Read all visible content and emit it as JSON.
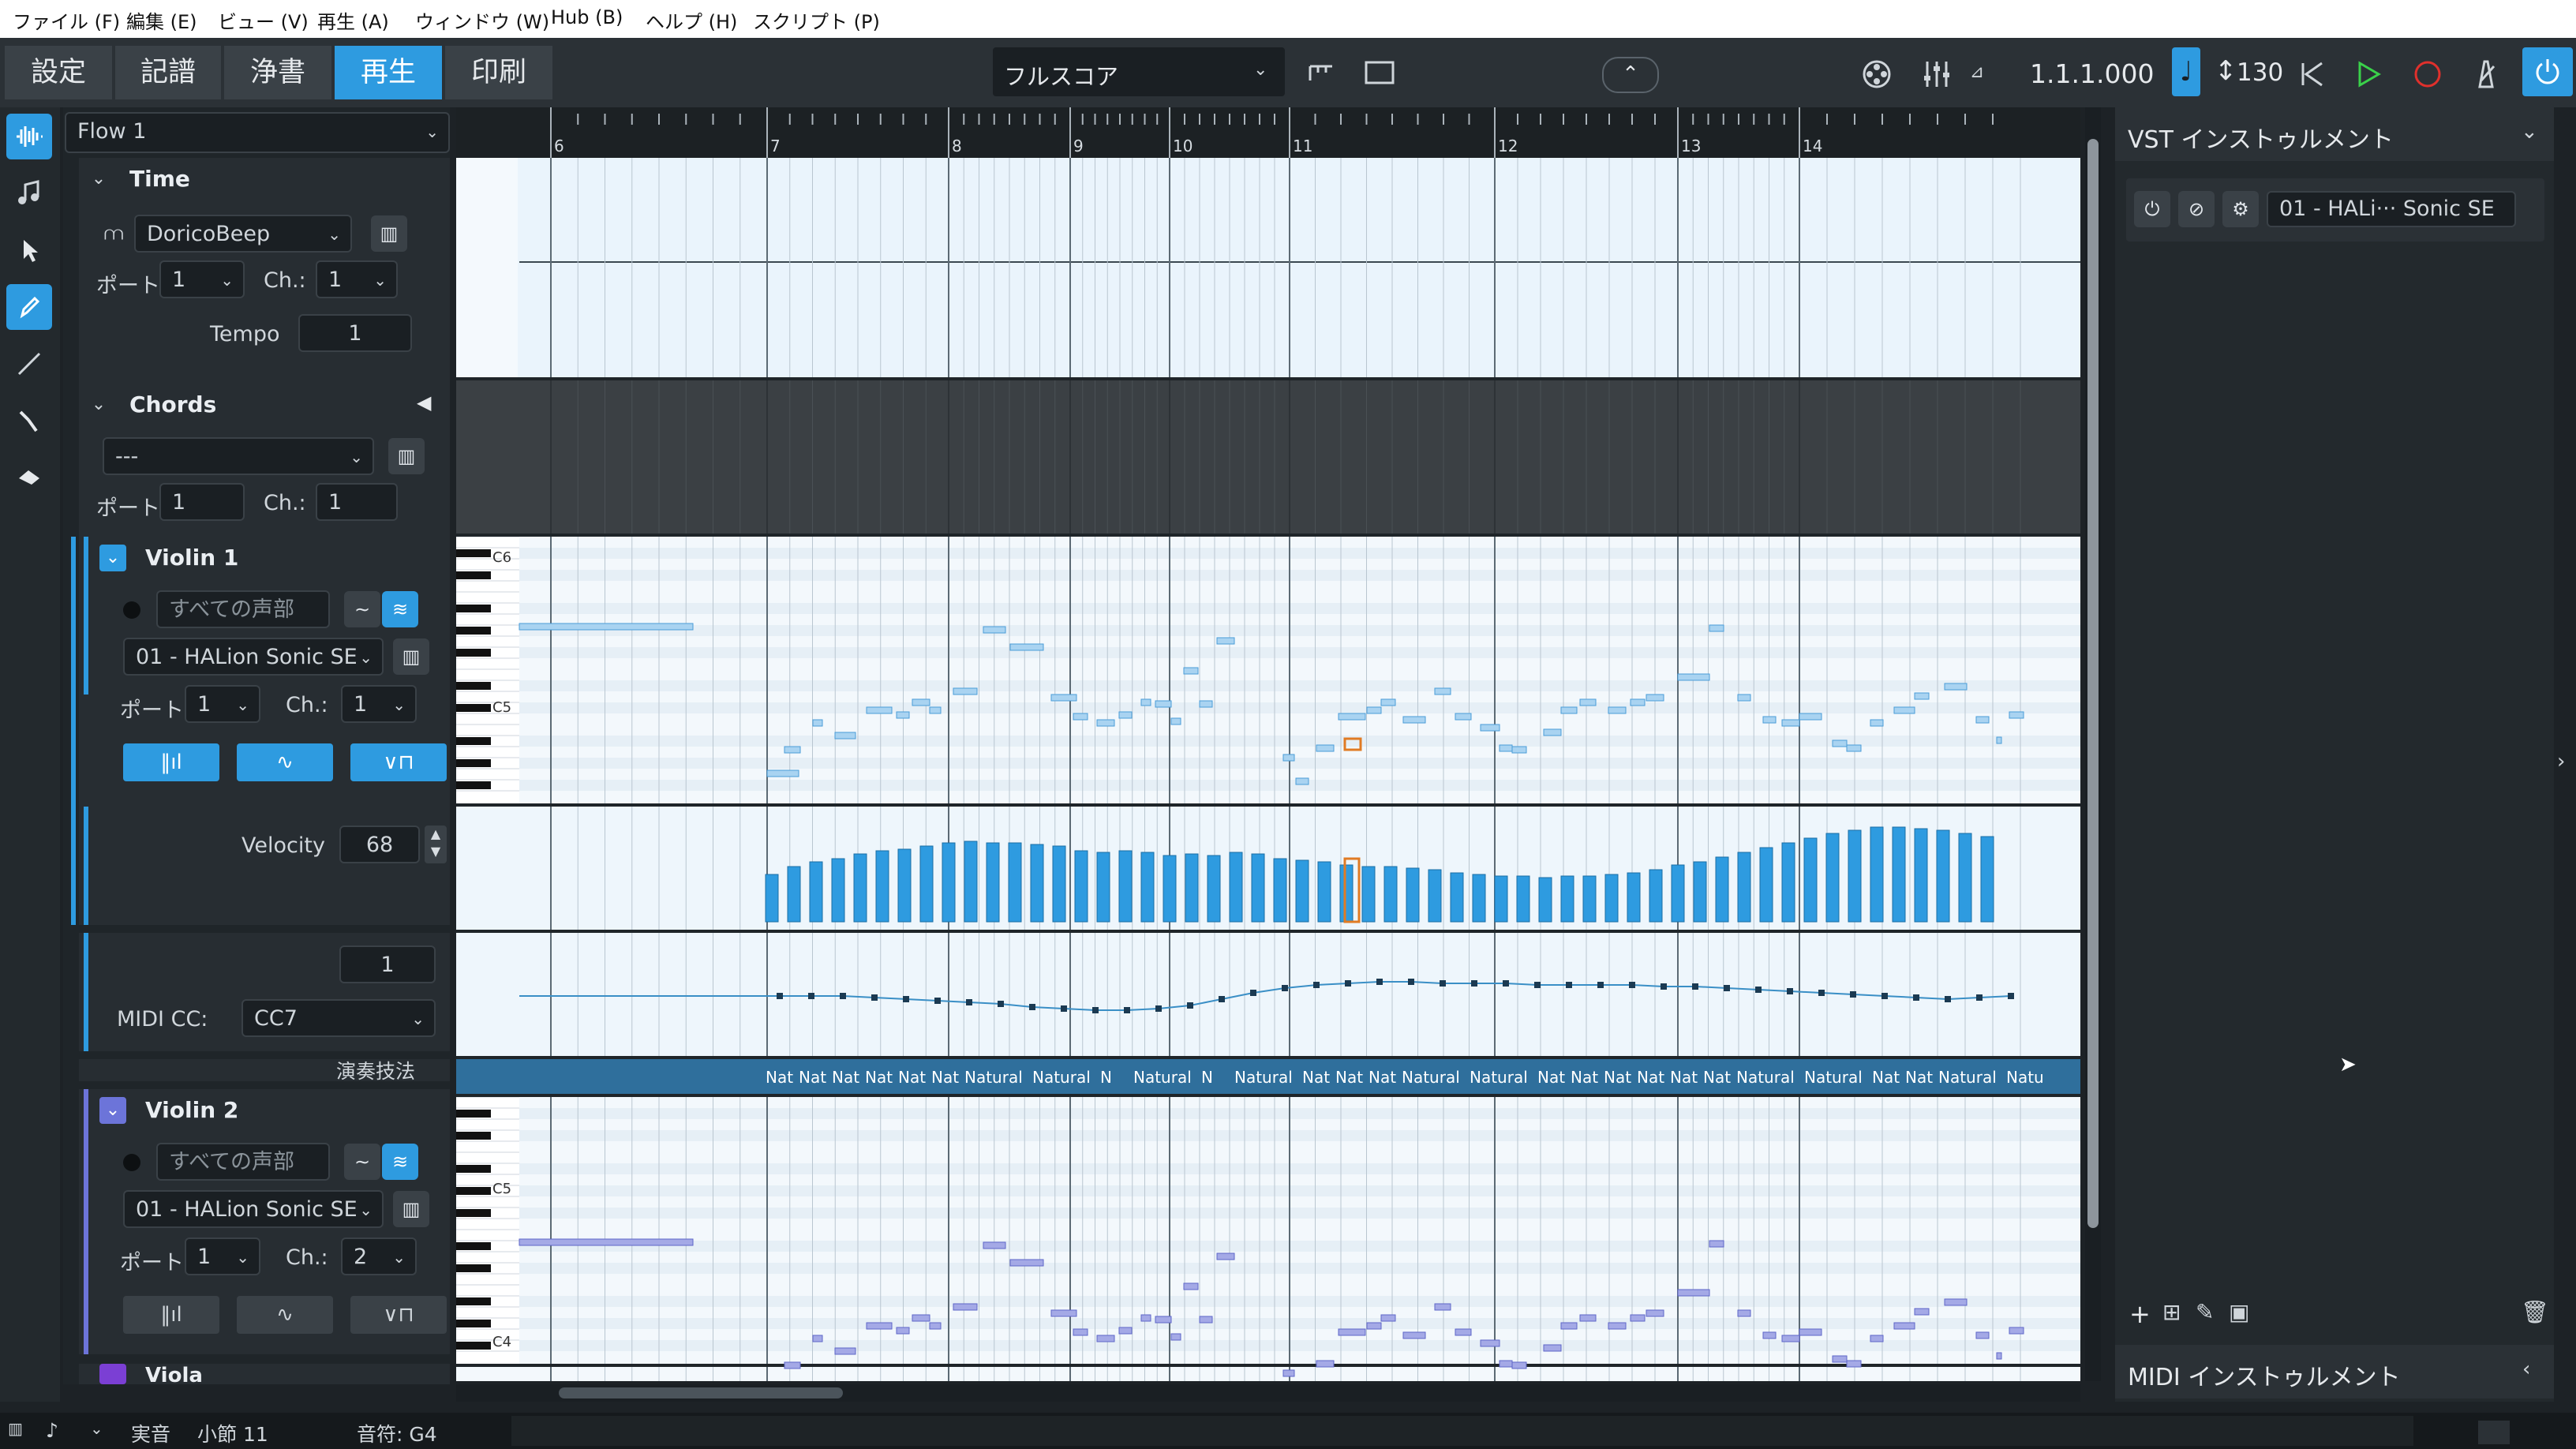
{
  "menubar": [
    "ファイル (F)",
    "編集 (E)",
    "ビュー (V)",
    "再生 (A)",
    "ウィンドウ (W)",
    "Hub (B)",
    "ヘルプ (H)",
    "スクリプト (P)"
  ],
  "toolbar": {
    "modes": [
      "設定",
      "記譜",
      "浄書",
      "再生",
      "印刷"
    ],
    "active_mode": "再生",
    "layout_select": "フルスコア",
    "position": "1.1.1.000",
    "tempo": "130"
  },
  "flow": {
    "name": "Flow 1"
  },
  "ruler": {
    "bars": [
      "6",
      "7",
      "8",
      "9",
      "10",
      "11",
      "12",
      "13",
      "14"
    ]
  },
  "time_track": {
    "title": "Time",
    "device": "DoricoBeep",
    "port_label": "ポート:",
    "port": "1",
    "ch_label": "Ch.:",
    "ch": "1",
    "tempo_label": "Tempo",
    "tempo_value": "1"
  },
  "chords_track": {
    "title": "Chords",
    "device": "---",
    "port_label": "ポート:",
    "port": "1",
    "ch_label": "Ch.:",
    "ch": "1"
  },
  "violin1": {
    "title": "Violin 1",
    "voices": "すべての声部",
    "instrument": "01 - HALion Sonic SE",
    "port_label": "ポート:",
    "port": "1",
    "ch_label": "Ch.:",
    "ch": "1",
    "key_c6": "C6",
    "key_c5": "C5",
    "velocity_label": "Velocity",
    "velocity": "68",
    "cc_value": "1",
    "midi_cc_label": "MIDI CC:",
    "midi_cc": "CC7",
    "technique_label": "演奏技法",
    "techniques": [
      "Nat",
      "Nat",
      "Nat",
      "Nat",
      "Nat",
      "Nat",
      "Natural",
      "Natural",
      "N",
      "Natural",
      "N",
      "Natural",
      "Nat",
      "Nat",
      "Nat",
      "Natural",
      "Natural",
      "Nat",
      "Nat",
      "Nat",
      "Nat",
      "Nat",
      "Nat",
      "Natural",
      "Natural",
      "Nat",
      "Nat",
      "Natural",
      "Natu"
    ]
  },
  "violin2": {
    "title": "Violin 2",
    "voices": "すべての声部",
    "instrument": "01 - HALion Sonic SE",
    "port_label": "ポート:",
    "port": "1",
    "ch_label": "Ch.:",
    "ch": "2",
    "key_c5": "C5",
    "key_c4": "C4"
  },
  "viola": {
    "title": "Viola"
  },
  "right_panel": {
    "vst_title": "VST インストゥルメント",
    "vst_instrument": "01 - HALi··· Sonic SE",
    "midi_title": "MIDI インストゥルメント"
  },
  "status": {
    "mode": "実音",
    "bar": "小節 11",
    "pitch": "音符: G4"
  },
  "colors": {
    "accent": "#2e9be0",
    "note_v1": "#a9d3f1",
    "note_v2": "#9ea4e4",
    "velocity": "#2e9be0"
  }
}
